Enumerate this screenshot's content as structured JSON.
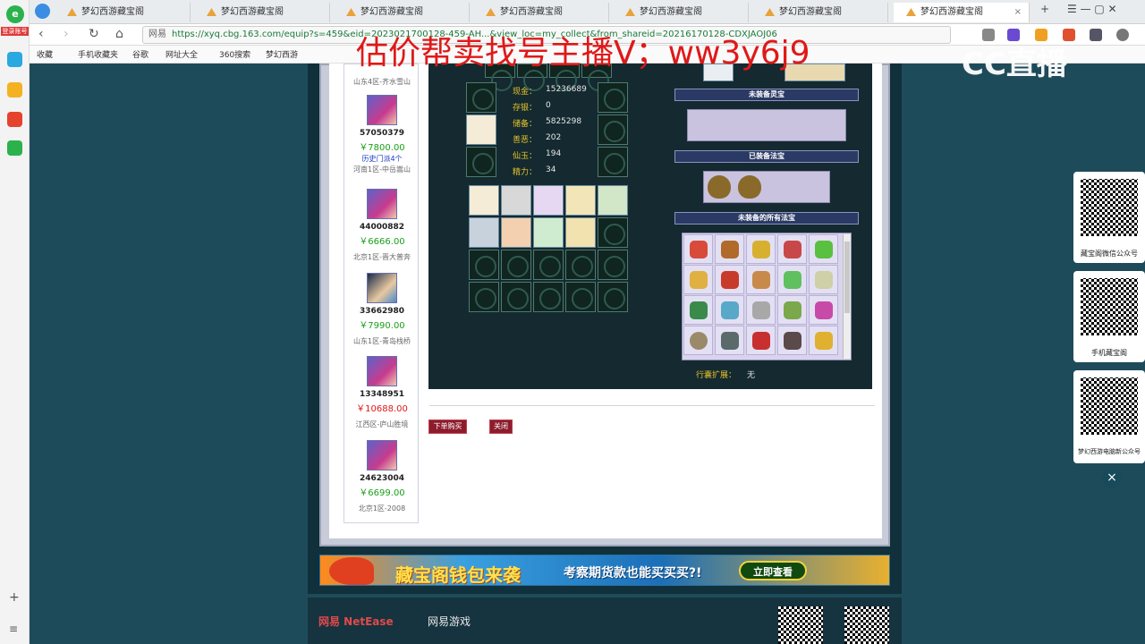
{
  "sidebar": {
    "login_label": "登录账号"
  },
  "tabs": [
    {
      "label": "梦幻西游藏宝阁"
    },
    {
      "label": "梦幻西游藏宝阁"
    },
    {
      "label": "梦幻西游藏宝阁"
    },
    {
      "label": "梦幻西游藏宝阁"
    },
    {
      "label": "梦幻西游藏宝阁"
    },
    {
      "label": "梦幻西游藏宝阁"
    },
    {
      "label": "梦幻西游藏宝阁",
      "active": true
    }
  ],
  "address": {
    "site_tag": "网易",
    "url": "https://xyq.cbg.163.com/equip?s=459&eid=2023021700128-459-AH...&view_loc=my_collect&from_shareid=20216170128-CDXJAOJ06",
    "url_short": "https://xyq.cbg.163.com/equip?s=459&eid=..."
  },
  "bookmarks": [
    "收藏",
    "手机收藏夹",
    "谷歌",
    "网址大全",
    "360搜索",
    "梦幻西游"
  ],
  "overlay_text": "估价帮卖找号主播V；ww3y6j9",
  "watermark": "CC直播",
  "sellers": [
    {
      "server": "山东4区-齐水雪山"
    },
    {
      "id": "57050379",
      "price": "￥7800.00",
      "history": "历史门派4个",
      "server": "河南1区-中岳嵩山"
    },
    {
      "id": "44000882",
      "price": "￥6666.00",
      "server": "北京1区-晋大普奔"
    },
    {
      "id": "33662980",
      "price": "￥7990.00",
      "server": "山东1区-青岛栈桥"
    },
    {
      "id": "13348951",
      "price": "￥10688.00",
      "price_red": true,
      "server": "江西区-庐山胜境"
    },
    {
      "id": "24623004",
      "price": "￥6699.00",
      "server": "北京1区-2008"
    }
  ],
  "stats": [
    {
      "label": "现金：",
      "value": "15236689"
    },
    {
      "label": "存银：",
      "value": "0"
    },
    {
      "label": "储备：",
      "value": "5825298"
    },
    {
      "label": "善恶：",
      "value": "202"
    },
    {
      "label": "仙玉：",
      "value": "194"
    },
    {
      "label": "精力：",
      "value": "34"
    }
  ],
  "sections": {
    "unequipped_lingbao": "未装备灵宝",
    "equipped_fabao": "已装备法宝",
    "all_fabao": "未装备的所有法宝",
    "bag_expand_label": "行囊扩展：",
    "bag_expand_value": "无"
  },
  "buttons": {
    "buy": "下单购买",
    "close": "关闭"
  },
  "banner": {
    "title": "藏宝阁钱包来袭",
    "subtitle": "考察期货款也能买买买?!",
    "cta": "立即查看"
  },
  "footer": {
    "netease": "网易 NetEase",
    "games": "网易游戏"
  },
  "qr_cards": [
    {
      "caption": "藏宝阁微信公众号"
    },
    {
      "caption": "手机藏宝阁"
    },
    {
      "caption": "梦幻西游电脑新公众号"
    }
  ],
  "colors": {
    "accent_red": "#e01818",
    "price_green": "#1aa01a",
    "stat_label": "#e6c12a"
  }
}
